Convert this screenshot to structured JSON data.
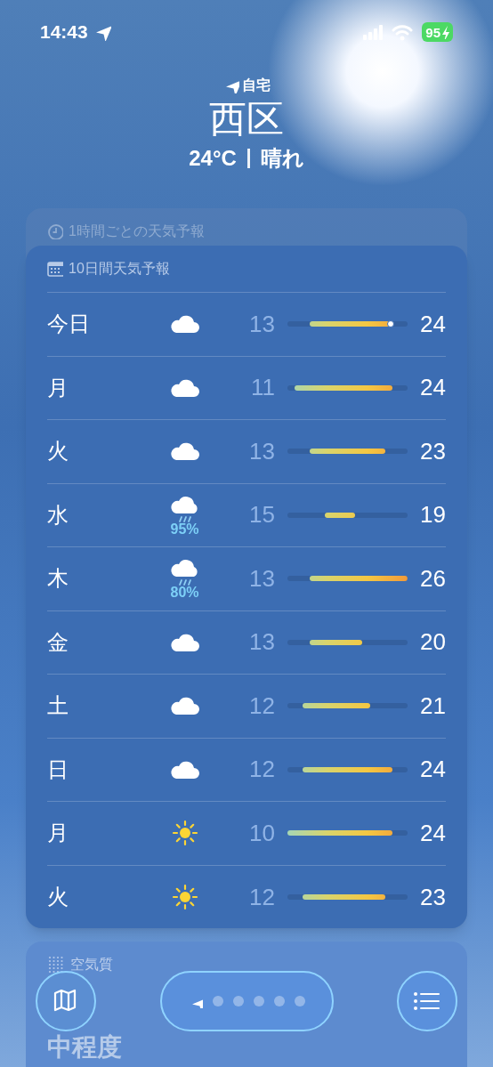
{
  "status_bar": {
    "time": "14:43",
    "battery": "95"
  },
  "header": {
    "location_label": "自宅",
    "city": "西区",
    "temperature": "24°C",
    "condition": "晴れ"
  },
  "hourly_card": {
    "title": "1時間ごとの天気予報"
  },
  "daily_card": {
    "title": "10日間天気予報",
    "days": [
      {
        "day": "今日",
        "kind": "cloud",
        "low": "13",
        "high": "24",
        "current": true
      },
      {
        "day": "月",
        "kind": "cloud",
        "low": "11",
        "high": "24",
        "current": false
      },
      {
        "day": "火",
        "kind": "cloud",
        "low": "13",
        "high": "23",
        "current": false
      },
      {
        "day": "水",
        "kind": "rain",
        "precipitation": "95%",
        "low": "15",
        "high": "19",
        "current": false
      },
      {
        "day": "木",
        "kind": "rain",
        "precipitation": "80%",
        "low": "13",
        "high": "26",
        "current": false
      },
      {
        "day": "金",
        "kind": "cloud",
        "low": "13",
        "high": "20",
        "current": false
      },
      {
        "day": "土",
        "kind": "cloud",
        "low": "12",
        "high": "21",
        "current": false
      },
      {
        "day": "日",
        "kind": "cloud",
        "low": "12",
        "high": "24",
        "current": false
      },
      {
        "day": "月",
        "kind": "sun",
        "low": "10",
        "high": "24",
        "current": false
      },
      {
        "day": "火",
        "kind": "sun",
        "low": "12",
        "high": "23",
        "current": false
      }
    ]
  },
  "air_quality_card": {
    "title": "空気質",
    "value": "中程度"
  },
  "pager": [
    {
      "kind": "location",
      "selected": true
    },
    {
      "kind": "dot",
      "selected": false
    },
    {
      "kind": "dot",
      "selected": false
    },
    {
      "kind": "dot",
      "selected": false
    },
    {
      "kind": "dot",
      "selected": false
    },
    {
      "kind": "dot",
      "selected": false
    }
  ]
}
